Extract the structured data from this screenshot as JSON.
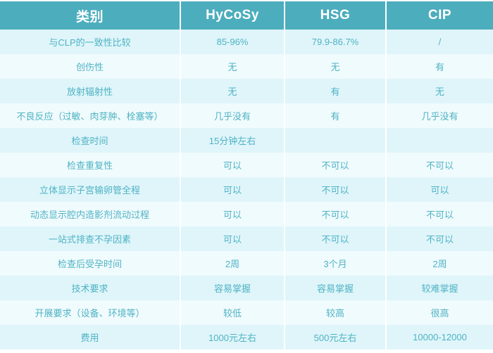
{
  "table": {
    "headers": [
      {
        "label": "类别",
        "name": "header-category"
      },
      {
        "label": "HyCoSy",
        "name": "header-hycosy"
      },
      {
        "label": "HSG",
        "name": "header-hsg"
      },
      {
        "label": "CIP",
        "name": "header-cip"
      }
    ],
    "rows": [
      {
        "category": "与CLP的一致性比较",
        "hycosy": "85-96%",
        "hsg": "79.9-86.7%",
        "cip": "/"
      },
      {
        "category": "创伤性",
        "hycosy": "无",
        "hsg": "无",
        "cip": "有"
      },
      {
        "category": "放射辐射性",
        "hycosy": "无",
        "hsg": "有",
        "cip": "无"
      },
      {
        "category": "不良反应（过敏、肉芽肿、栓塞等）",
        "hycosy": "几乎没有",
        "hsg": "有",
        "cip": "几乎没有"
      },
      {
        "category": "检查时间",
        "hycosy": "15分钟左右",
        "hsg": "",
        "cip": ""
      },
      {
        "category": "检查重复性",
        "hycosy": "可以",
        "hsg": "不可以",
        "cip": "不可以"
      },
      {
        "category": "立体显示子宫输卵管全程",
        "hycosy": "可以",
        "hsg": "不可以",
        "cip": "可以"
      },
      {
        "category": "动态显示腔内造影剂流动过程",
        "hycosy": "可以",
        "hsg": "不可以",
        "cip": "不可以"
      },
      {
        "category": "一站式排查不孕因素",
        "hycosy": "可以",
        "hsg": "不可以",
        "cip": "不可以"
      },
      {
        "category": "检查后受孕时间",
        "hycosy": "2周",
        "hsg": "3个月",
        "cip": "2周"
      },
      {
        "category": "技术要求",
        "hycosy": "容易掌握",
        "hsg": "容易掌握",
        "cip": "较难掌握"
      },
      {
        "category": "开展要求（设备、环境等）",
        "hycosy": "较低",
        "hsg": "较高",
        "cip": "很高"
      },
      {
        "category": "费用",
        "hycosy": "1000元左右",
        "hsg": "500元左右",
        "cip": "10000-12000"
      }
    ]
  },
  "colors": {
    "header_bg": "#4cadbd",
    "header_text": "#ffffff",
    "row_a_bg": "#dff5fa",
    "row_b_bg": "#f0fbfd",
    "cell_text": "#4fb3c4",
    "divider": "#ffffff",
    "page_bg": "#ffffff"
  }
}
